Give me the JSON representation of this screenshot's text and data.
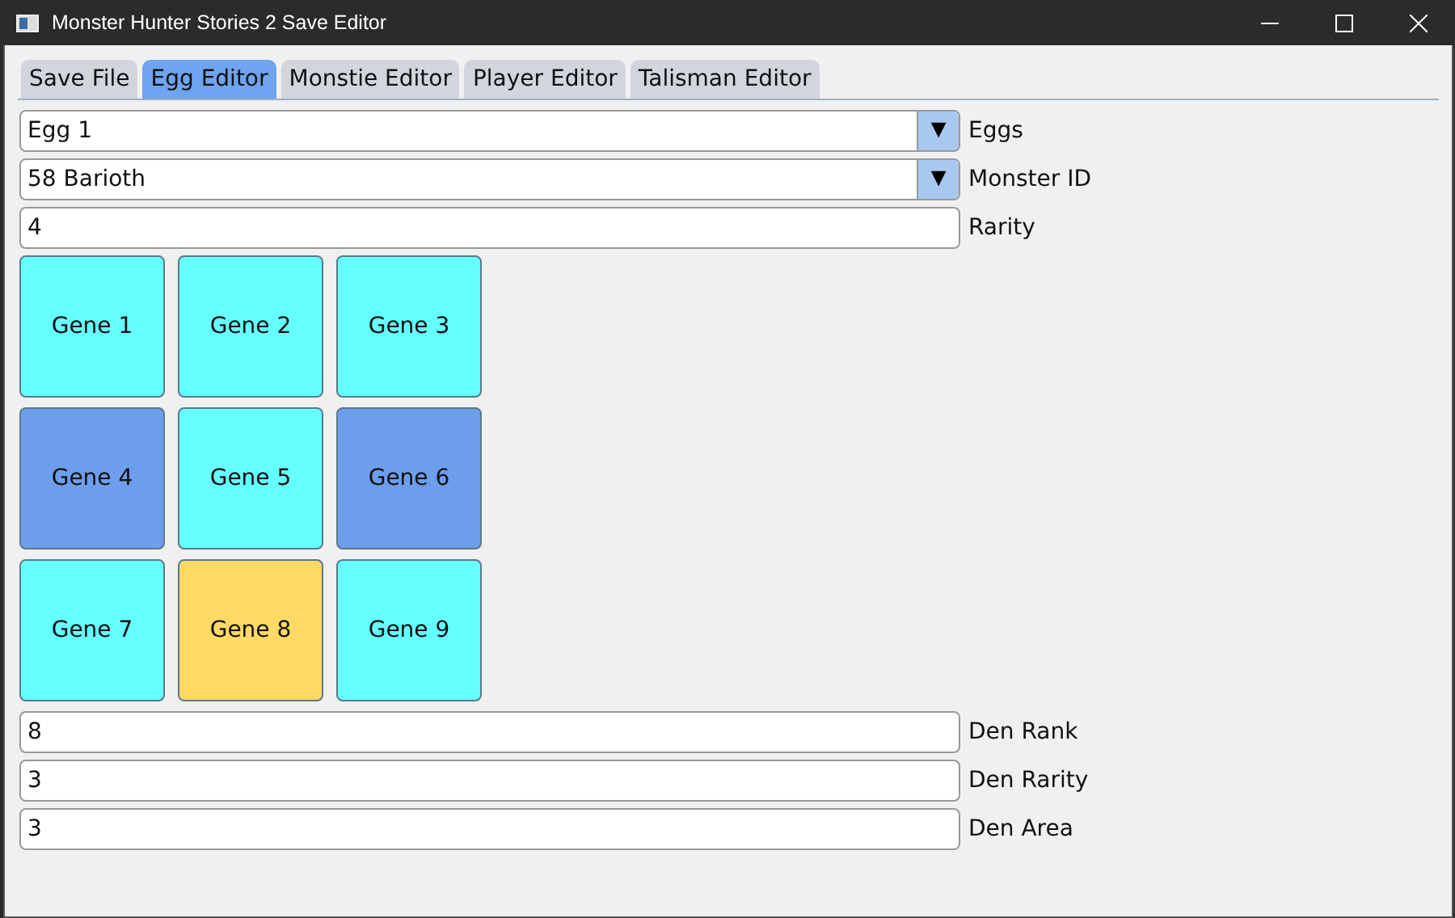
{
  "window": {
    "title": "Monster Hunter Stories 2 Save Editor"
  },
  "tabs": [
    {
      "label": "Save File",
      "selected": false
    },
    {
      "label": "Egg Editor",
      "selected": true
    },
    {
      "label": "Monstie Editor",
      "selected": false
    },
    {
      "label": "Player Editor",
      "selected": false
    },
    {
      "label": "Talisman Editor",
      "selected": false
    }
  ],
  "top_fields": [
    {
      "kind": "dropdown",
      "value": "Egg 1",
      "label": "Eggs",
      "arrow": "▼"
    },
    {
      "kind": "dropdown",
      "value": "58 Barioth",
      "label": "Monster ID",
      "arrow": "▼"
    },
    {
      "kind": "text",
      "value": "4",
      "label": "Rarity"
    }
  ],
  "genes": [
    {
      "label": "Gene 1",
      "color": "#66ffff"
    },
    {
      "label": "Gene 2",
      "color": "#66ffff"
    },
    {
      "label": "Gene 3",
      "color": "#66ffff"
    },
    {
      "label": "Gene 4",
      "color": "#6d9eeb"
    },
    {
      "label": "Gene 5",
      "color": "#66ffff"
    },
    {
      "label": "Gene 6",
      "color": "#6d9eeb"
    },
    {
      "label": "Gene 7",
      "color": "#66ffff"
    },
    {
      "label": "Gene 8",
      "color": "#ffd966"
    },
    {
      "label": "Gene 9",
      "color": "#66ffff"
    }
  ],
  "bottom_fields": [
    {
      "value": "8",
      "label": "Den Rank"
    },
    {
      "value": "3",
      "label": "Den Rarity"
    },
    {
      "value": "3",
      "label": "Den Area"
    }
  ]
}
